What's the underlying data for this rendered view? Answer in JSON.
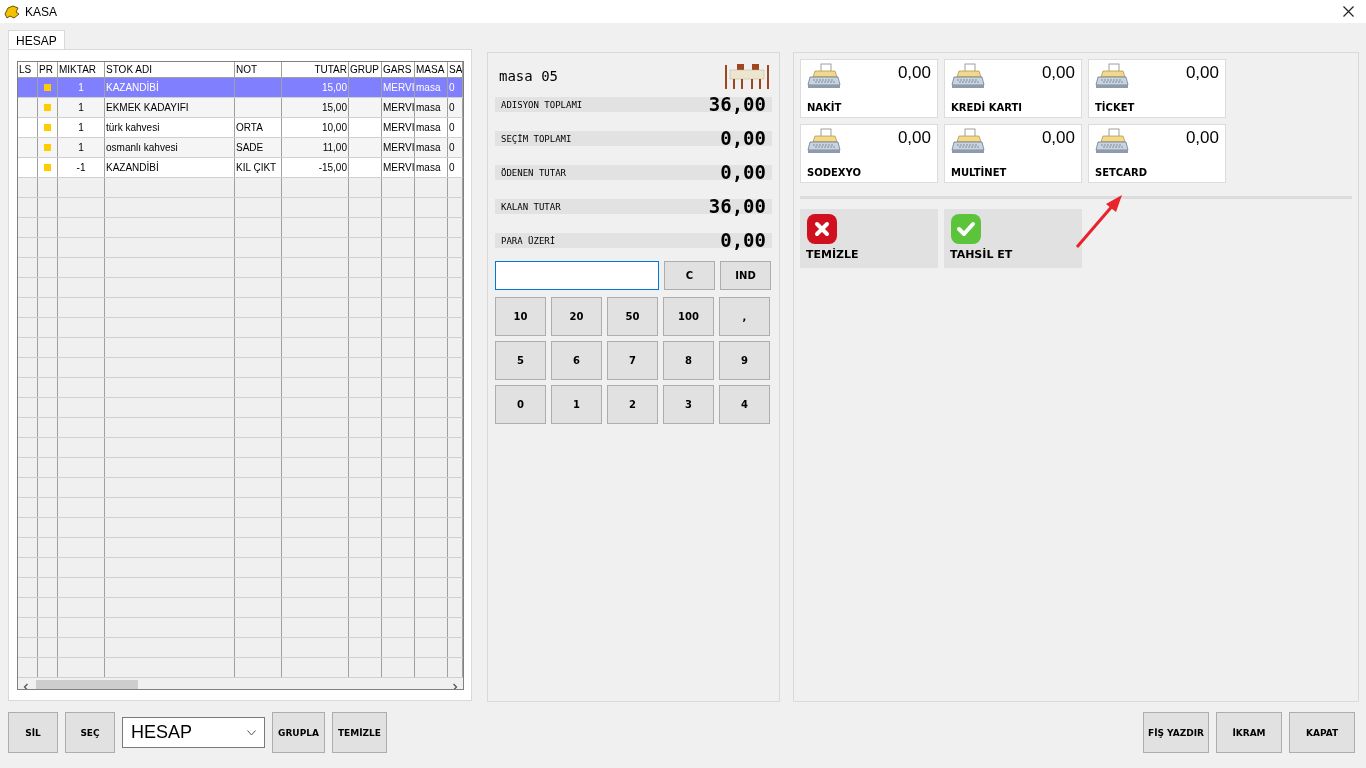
{
  "window": {
    "title": "KASA"
  },
  "tabs": [
    {
      "label": "HESAP",
      "selected": true
    }
  ],
  "grid": {
    "columns": [
      "LS",
      "PR",
      "MIKTAR",
      "STOK ADI",
      "NOT",
      "TUTAR",
      "GRUP",
      "GARS",
      "MASA",
      "SA"
    ],
    "rows": [
      {
        "selected": true,
        "printed": true,
        "qty": "1",
        "name": "KAZANDİBİ",
        "note": "",
        "amount": "15,00",
        "group": "",
        "waiter": "MERVI",
        "table": "masa",
        "col10": "0"
      },
      {
        "selected": false,
        "printed": true,
        "qty": "1",
        "name": "EKMEK KADAYIFI",
        "note": "",
        "amount": "15,00",
        "group": "",
        "waiter": "MERVI",
        "table": "masa",
        "col10": "0"
      },
      {
        "selected": false,
        "printed": true,
        "qty": "1",
        "name": "türk kahvesi",
        "note": "ORTA",
        "amount": "10,00",
        "group": "",
        "waiter": "MERVI",
        "table": "masa",
        "col10": "0"
      },
      {
        "selected": false,
        "printed": true,
        "qty": "1",
        "name": "osmanlı kahvesi",
        "note": "SADE",
        "amount": "11,00",
        "group": "",
        "waiter": "MERVI",
        "table": "masa",
        "col10": "0"
      },
      {
        "selected": false,
        "printed": true,
        "qty": "-1",
        "name": "KAZANDİBİ",
        "note": "KIL ÇIKT",
        "amount": "-15,00",
        "group": "",
        "waiter": "MERVI",
        "table": "masa",
        "col10": "0"
      }
    ]
  },
  "bottom_left": {
    "buttons": [
      "SİL",
      "SEÇ"
    ],
    "dropdown": {
      "value": "HESAP"
    },
    "buttons_after": [
      "GRUPLA",
      "TEMİZLE"
    ]
  },
  "summary": {
    "table_name": "masa 05",
    "totals": [
      {
        "label": "ADISYON TOPLAMI",
        "value": "36,00"
      },
      {
        "label": "SEÇİM TOPLAMI",
        "value": "0,00"
      },
      {
        "label": "ÖDENEN TUTAR",
        "value": "0,00"
      },
      {
        "label": "KALAN TUTAR",
        "value": "36,00"
      },
      {
        "label": "PARA ÜZERİ",
        "value": "0,00"
      }
    ]
  },
  "keypad": {
    "top_keys": [
      "C",
      "IND"
    ],
    "keys": [
      "10",
      "20",
      "50",
      "100",
      ",",
      "5",
      "6",
      "7",
      "8",
      "9",
      "0",
      "1",
      "2",
      "3",
      "4"
    ]
  },
  "payments": [
    {
      "label": "NAKİT",
      "value": "0,00"
    },
    {
      "label": "KREDİ KARTI",
      "value": "0,00"
    },
    {
      "label": "TİCKET",
      "value": "0,00"
    },
    {
      "label": "SODEXYO",
      "value": "0,00"
    },
    {
      "label": "MULTİNET",
      "value": "0,00"
    },
    {
      "label": "SETCARD",
      "value": "0,00"
    }
  ],
  "actions": [
    {
      "kind": "clear",
      "label": "TEMİZLE"
    },
    {
      "kind": "collect",
      "label": "TAHSİL ET"
    }
  ],
  "bottom_right": {
    "buttons": [
      "FİŞ YAZDIR",
      "İKRAM",
      "KAPAT"
    ]
  }
}
